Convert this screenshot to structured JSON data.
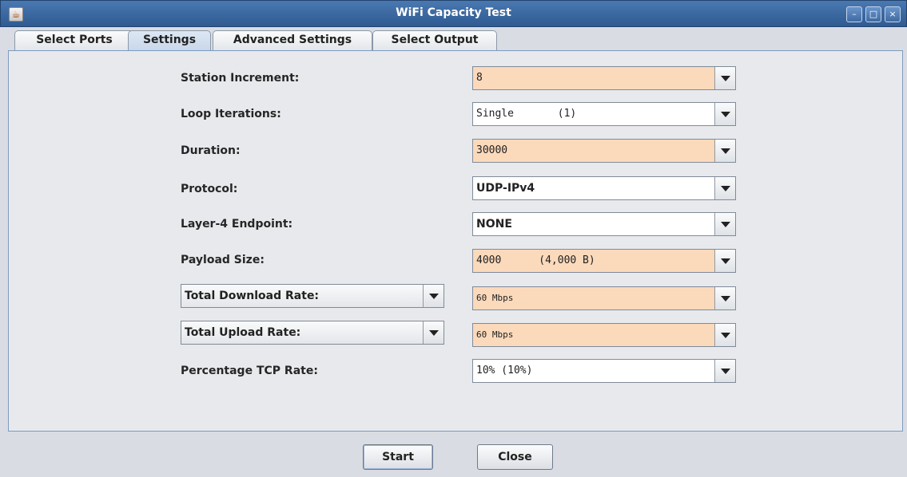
{
  "window": {
    "title": "WiFi Capacity Test",
    "app_icon": "java-icon",
    "minimize_glyph": "–",
    "maximize_glyph": "□",
    "close_glyph": "×"
  },
  "tabs": [
    {
      "label": "Select Ports",
      "selected": false
    },
    {
      "label": "Settings",
      "selected": true
    },
    {
      "label": "Advanced Settings",
      "selected": false
    },
    {
      "label": "Select Output",
      "selected": false
    }
  ],
  "settings": {
    "station_increment": {
      "label": "Station Increment:",
      "value": "8"
    },
    "loop_iterations": {
      "label": "Loop Iterations:",
      "value": "Single       (1)"
    },
    "duration": {
      "label": "Duration:",
      "value": "30000"
    },
    "protocol": {
      "label": "Protocol:",
      "value": "UDP-IPv4"
    },
    "layer4_endpoint": {
      "label": "Layer-4 Endpoint:",
      "value": "NONE"
    },
    "payload_size": {
      "label": "Payload Size:",
      "value": "4000      (4,000 B)"
    },
    "download_rate": {
      "label": "Total Download Rate:",
      "value": "60 Mbps"
    },
    "upload_rate": {
      "label": "Total Upload Rate:",
      "value": "60 Mbps"
    },
    "tcp_rate": {
      "label": "Percentage TCP Rate:",
      "value": "10% (10%)"
    }
  },
  "buttons": {
    "start": "Start",
    "close": "Close"
  },
  "colors": {
    "titlebar": "#2f5a92",
    "modified_field": "#fbd9bb",
    "panel_border": "#7d9ac0"
  }
}
